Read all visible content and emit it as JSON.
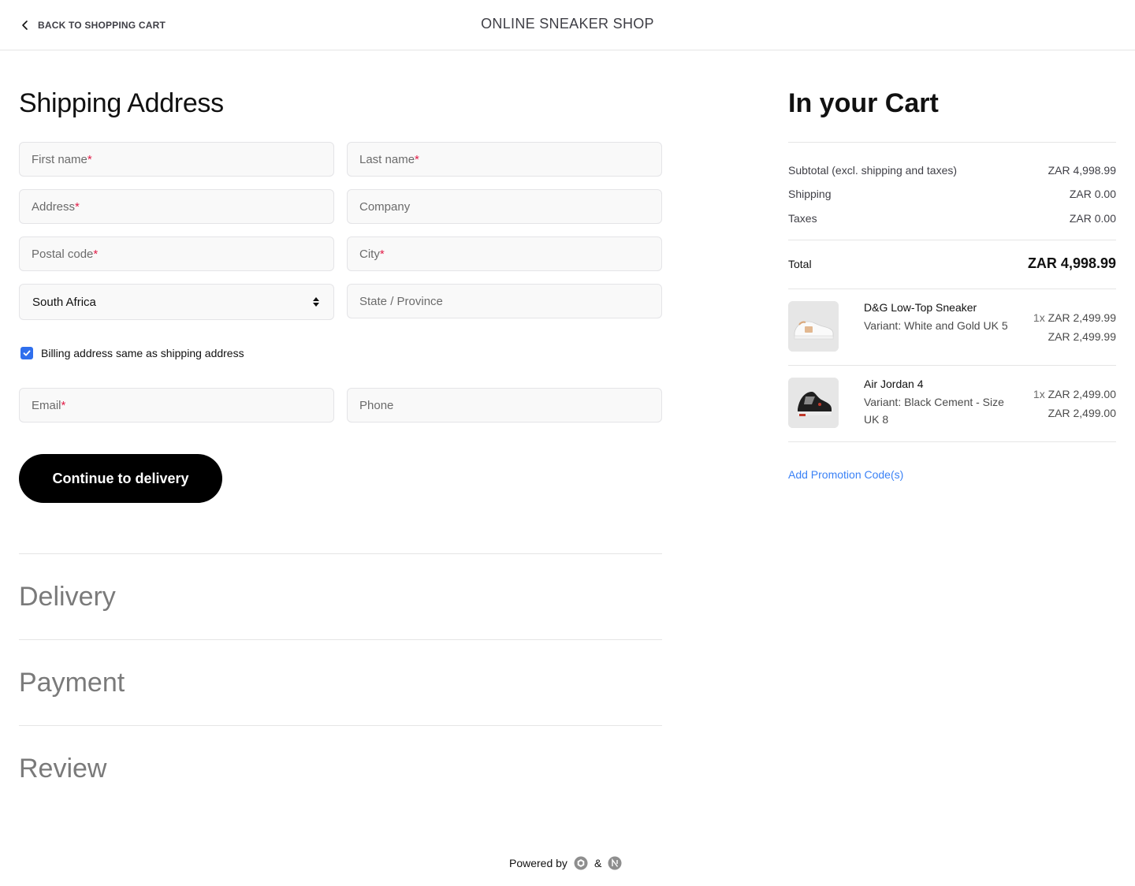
{
  "header": {
    "back_label": "BACK TO SHOPPING CART",
    "shop_title": "ONLINE SNEAKER SHOP"
  },
  "shipping": {
    "title": "Shipping Address",
    "fields": {
      "first_name": {
        "label": "First name",
        "required": "*",
        "value": ""
      },
      "last_name": {
        "label": "Last name",
        "required": "*",
        "value": ""
      },
      "address": {
        "label": "Address",
        "required": "*",
        "value": ""
      },
      "company": {
        "label": "Company",
        "value": ""
      },
      "postal_code": {
        "label": "Postal code",
        "required": "*",
        "value": ""
      },
      "city": {
        "label": "City",
        "required": "*",
        "value": ""
      },
      "country": {
        "selected": "South Africa"
      },
      "state": {
        "label": "State / Province",
        "value": ""
      },
      "email": {
        "label": "Email",
        "required": "*",
        "value": ""
      },
      "phone": {
        "label": "Phone",
        "value": ""
      }
    },
    "billing_same_label": "Billing address same as shipping address",
    "billing_same_checked": true,
    "continue_label": "Continue to delivery"
  },
  "steps": {
    "delivery": "Delivery",
    "payment": "Payment",
    "review": "Review"
  },
  "cart": {
    "title": "In your Cart",
    "subtotal_label": "Subtotal (excl. shipping and taxes)",
    "subtotal_value": "ZAR 4,998.99",
    "shipping_label": "Shipping",
    "shipping_value": "ZAR 0.00",
    "taxes_label": "Taxes",
    "taxes_value": "ZAR 0.00",
    "total_label": "Total",
    "total_value": "ZAR 4,998.99",
    "items": [
      {
        "name": "D&G Low-Top Sneaker",
        "variant": "Variant: White and Gold UK 5",
        "qty": "1x",
        "unit_price": "ZAR 2,499.99",
        "line_total": "ZAR 2,499.99",
        "thumb_icon": "white-sneaker-image"
      },
      {
        "name": "Air Jordan 4",
        "variant": "Variant: Black Cement - Size UK 8",
        "qty": "1x",
        "unit_price": "ZAR 2,499.00",
        "line_total": "ZAR 2,499.00",
        "thumb_icon": "black-sneaker-image"
      }
    ],
    "promo_label": "Add Promotion Code(s)"
  },
  "footer": {
    "powered_by": "Powered by",
    "amp": "&",
    "logos": [
      "medusa-logo-icon",
      "next-logo-icon"
    ]
  },
  "colors": {
    "accent_link": "#3b82f6",
    "checkbox": "#2f6fed",
    "required": "#e11d48",
    "button_bg": "#000000"
  }
}
